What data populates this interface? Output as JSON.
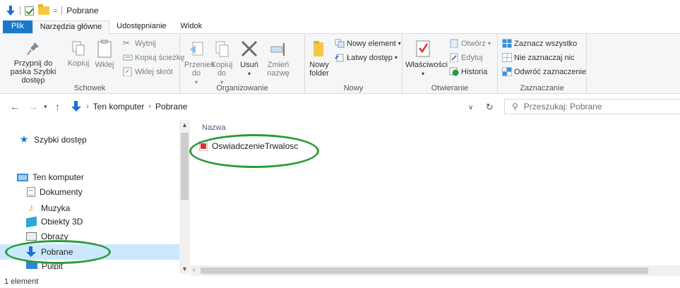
{
  "title_bar": {
    "title": "Pobrane",
    "quick_access_dropdown": "="
  },
  "ribbon_tabs": [
    {
      "label": "Plik"
    },
    {
      "label": "Narzędzia główne"
    },
    {
      "label": "Udostępnianie"
    },
    {
      "label": "Widok"
    }
  ],
  "ribbon": {
    "schowek": {
      "label": "Schowek",
      "pin": "Przypnij do paska Szybki dostęp",
      "copy": "Kopiuj",
      "paste": "Wklej",
      "cut": "Wytnij",
      "copy_path": "Kopiuj ścieżkę",
      "paste_shortcut": "Wklej skrót"
    },
    "organizowanie": {
      "label": "Organizowanie",
      "move_to": "Przenieś do",
      "copy_to": "Kopiuj do",
      "delete": "Usuń",
      "rename": "Zmień nazwę"
    },
    "nowy": {
      "label": "Nowy",
      "new_folder": "Nowy folder",
      "new_item": "Nowy element",
      "easy_access": "Łatwy dostęp"
    },
    "otwieranie": {
      "label": "Otwieranie",
      "properties": "Właściwości",
      "open": "Otwórz",
      "edit": "Edytuj",
      "history": "Historia"
    },
    "zaznaczanie": {
      "label": "Zaznaczanie",
      "select_all": "Zaznacz wszystko",
      "select_none": "Nie zaznaczaj nic",
      "invert": "Odwróć zaznaczenie"
    }
  },
  "address_bar": {
    "crumbs": [
      "Ten komputer",
      "Pobrane"
    ],
    "search_placeholder": "Przeszukaj: Pobrane"
  },
  "nav_pane": {
    "quick_access": "Szybki dostęp",
    "this_pc": "Ten komputer",
    "items": [
      "Dokumenty",
      "Muzyka",
      "Obiekty 3D",
      "Obrazy",
      "Pobrane",
      "Pulpit"
    ],
    "selected": "Pobrane"
  },
  "content": {
    "column_name": "Nazwa",
    "files": [
      {
        "name": "OswiadczenieTrwalosc",
        "type": "pdf"
      }
    ]
  },
  "status_bar": {
    "text": "1 element"
  },
  "colors": {
    "accent": "#1979ca",
    "selection": "#cce8ff",
    "annotation": "#2a9a3a"
  }
}
